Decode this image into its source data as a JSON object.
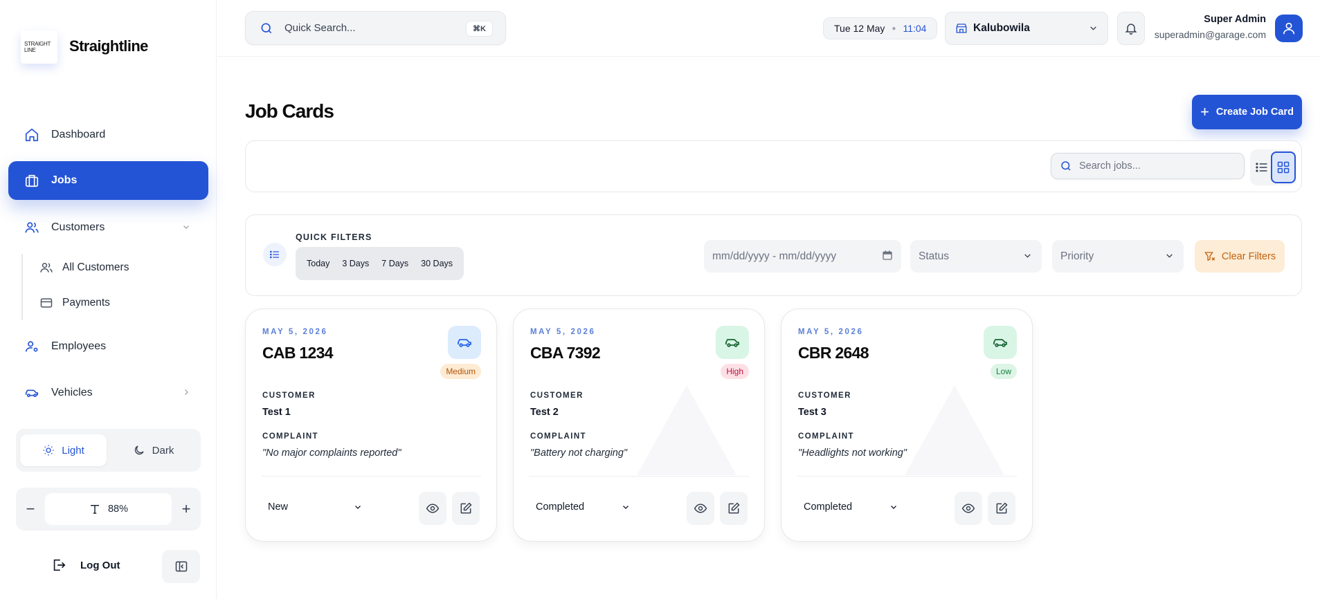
{
  "brand": {
    "logo_line1": "STRAIGHT",
    "logo_line2": "LINE",
    "name": "Straightline"
  },
  "sidebar": {
    "items": [
      {
        "label": "Dashboard",
        "icon": "home-icon"
      },
      {
        "label": "Jobs",
        "icon": "briefcase-icon",
        "active": true
      },
      {
        "label": "Customers",
        "icon": "users-icon",
        "expanded": true
      },
      {
        "label": "Employees",
        "icon": "user-cog-icon"
      },
      {
        "label": "Vehicles",
        "icon": "car-icon"
      }
    ],
    "sub_items": [
      {
        "label": "All Customers",
        "icon": "users-icon"
      },
      {
        "label": "Payments",
        "icon": "credit-card-icon"
      }
    ],
    "theme": {
      "light_label": "Light",
      "dark_label": "Dark",
      "selected": "Light"
    },
    "zoom": {
      "minus": "−",
      "value": "88%",
      "plus": "+"
    },
    "logout_label": "Log Out"
  },
  "header": {
    "search_placeholder": "Quick Search...",
    "search_shortcut": "⌘K",
    "date": "Tue 12 May",
    "time": "11:04",
    "branch": "Kalubowila",
    "user_name": "Super Admin",
    "user_email": "superadmin@garage.com"
  },
  "main": {
    "title": "Job Cards",
    "create_label": "Create Job Card",
    "job_search_placeholder": "Search jobs...",
    "view_mode": "grid"
  },
  "filters": {
    "quick_label": "QUICK FILTERS",
    "quick_options": [
      "Today",
      "3 Days",
      "7 Days",
      "30 Days"
    ],
    "date_range_placeholder": "mm/dd/yyyy - mm/dd/yyyy",
    "status_placeholder": "Status",
    "priority_placeholder": "Priority",
    "clear_label": "Clear Filters"
  },
  "card_labels": {
    "customer": "CUSTOMER",
    "complaint": "COMPLAINT"
  },
  "jobs": [
    {
      "date": "MAY 5, 2026",
      "plate": "CAB 1234",
      "priority": "Medium",
      "customer": "Test 1",
      "complaint": "\"No major complaints reported\"",
      "status": "New"
    },
    {
      "date": "MAY 5, 2026",
      "plate": "CBA 7392",
      "priority": "High",
      "customer": "Test 2",
      "complaint": "\"Battery not charging\"",
      "status": "Completed"
    },
    {
      "date": "MAY 5, 2026",
      "plate": "CBR 2648",
      "priority": "Low",
      "customer": "Test 3",
      "complaint": "\"Headlights not working\"",
      "status": "Completed"
    }
  ],
  "colors": {
    "accent": "#2454d6",
    "priority_medium_bg": "#fdebd3",
    "priority_medium_fg": "#b45309",
    "priority_high_bg": "#fde0e6",
    "priority_high_fg": "#be123c",
    "priority_low_bg": "#dcf5e6",
    "priority_low_fg": "#15803d"
  }
}
